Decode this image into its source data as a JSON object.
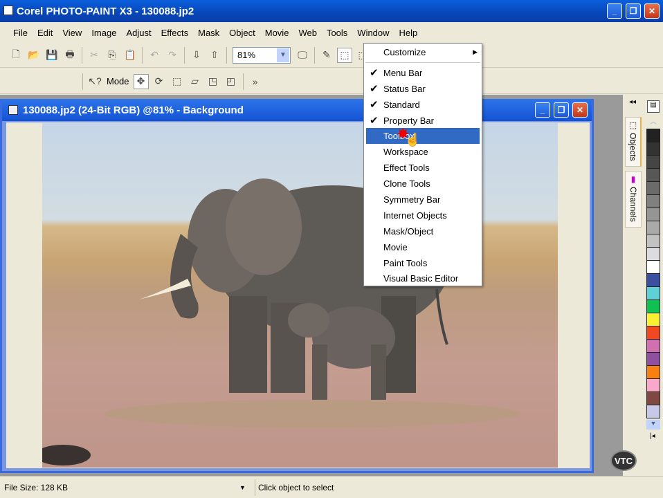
{
  "window": {
    "title": "Corel PHOTO-PAINT X3 - 130088.jp2"
  },
  "menubar": [
    "File",
    "Edit",
    "View",
    "Image",
    "Adjust",
    "Effects",
    "Mask",
    "Object",
    "Movie",
    "Web",
    "Tools",
    "Window",
    "Help"
  ],
  "toolbar": {
    "zoom_value": "81%"
  },
  "property_bar": {
    "mode_label": "Mode"
  },
  "document": {
    "title": "130088.jp2 (24-Bit RGB) @81% - Background"
  },
  "tools_menu": {
    "customize": "Customize",
    "items": [
      {
        "label": "Menu Bar",
        "checked": true
      },
      {
        "label": "Status Bar",
        "checked": true
      },
      {
        "label": "Standard",
        "checked": true
      },
      {
        "label": "Property Bar",
        "checked": true
      },
      {
        "label": "Toolbox",
        "checked": false,
        "highlighted": true
      },
      {
        "label": "Workspace",
        "checked": false
      },
      {
        "label": "Effect Tools",
        "checked": false
      },
      {
        "label": "Clone Tools",
        "checked": false
      },
      {
        "label": "Symmetry Bar",
        "checked": false
      },
      {
        "label": "Internet Objects",
        "checked": false
      },
      {
        "label": "Mask/Object",
        "checked": false
      },
      {
        "label": "Movie",
        "checked": false
      },
      {
        "label": "Paint Tools",
        "checked": false
      },
      {
        "label": "Visual Basic Editor",
        "checked": false
      }
    ]
  },
  "dockers": {
    "objects": "Objects",
    "channels": "Channels"
  },
  "palette": [
    "#222222",
    "#333333",
    "#454545",
    "#575757",
    "#6b6b6b",
    "#808080",
    "#959595",
    "#aaaaaa",
    "#c2c2c2",
    "#dcdce0",
    "#ffffff",
    "#3a4fa0",
    "#60d0d8",
    "#10c050",
    "#f8f030",
    "#f04820",
    "#d070b0",
    "#9050a0",
    "#f88010",
    "#f8a8c8",
    "#804840",
    "#c8c8e8"
  ],
  "status": {
    "file_size": "File Size: 128 KB",
    "hint": "Click object to select"
  },
  "watermark": "VTC"
}
